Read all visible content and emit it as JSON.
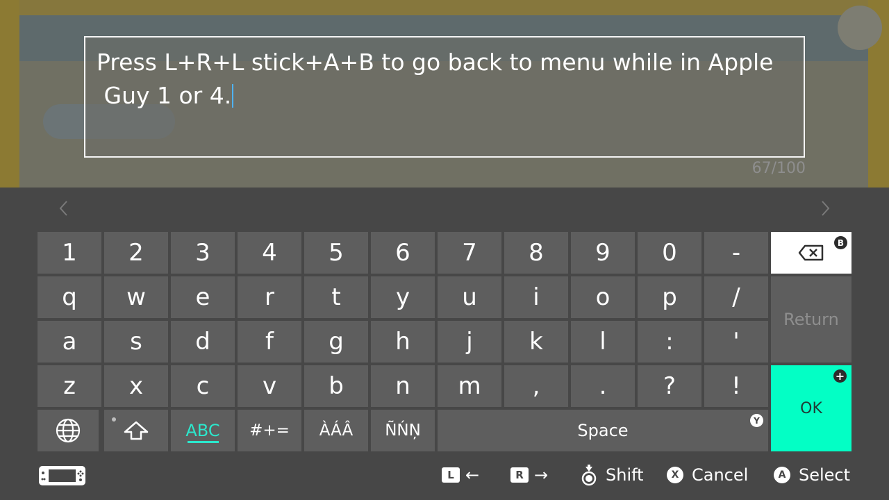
{
  "text_field": {
    "value": "Press L+R+L stick+A+B to go back to menu while in Apple\n Guy 1 or 4.",
    "char_count": "67/100"
  },
  "navigation": {
    "prev_icon": "chevron-left-icon",
    "next_icon": "chevron-right-icon"
  },
  "keyboard": {
    "row1": [
      "1",
      "2",
      "3",
      "4",
      "5",
      "6",
      "7",
      "8",
      "9",
      "0",
      "-"
    ],
    "row2": [
      "q",
      "w",
      "e",
      "r",
      "t",
      "y",
      "u",
      "i",
      "o",
      "p",
      "/"
    ],
    "row3": [
      "a",
      "s",
      "d",
      "f",
      "g",
      "h",
      "j",
      "k",
      "l",
      ":",
      "'"
    ],
    "row4": [
      "z",
      "x",
      "c",
      "v",
      "b",
      "n",
      "m",
      ",",
      ".",
      "?",
      "!"
    ],
    "backspace": {
      "icon": "backspace-icon",
      "badge": "B"
    },
    "return_label": "Return",
    "ok_label": "OK",
    "ok_badge_icon": "plus-icon",
    "bottom_row": {
      "globe_icon": "globe-icon",
      "shift_icon": "shift-arrow-icon",
      "abc_label": "ABC",
      "symbols_label": "#+=",
      "accents_a_label": "ÀÁÂ",
      "accents_n_label": "ÑŃŅ",
      "space_label": "Space",
      "space_badge": "Y"
    }
  },
  "footer": {
    "console_icon": "handheld-console-icon",
    "l_button": "L",
    "r_button": "R",
    "shift_label": "Shift",
    "cancel_button": "X",
    "cancel_label": "Cancel",
    "select_button": "A",
    "select_label": "Select"
  },
  "colors": {
    "accent": "#2ce7cc",
    "ok_background": "#03ffc5",
    "key_background": "#5e5e5e",
    "panel_background": "#474747",
    "caret": "#4fb3ff"
  }
}
